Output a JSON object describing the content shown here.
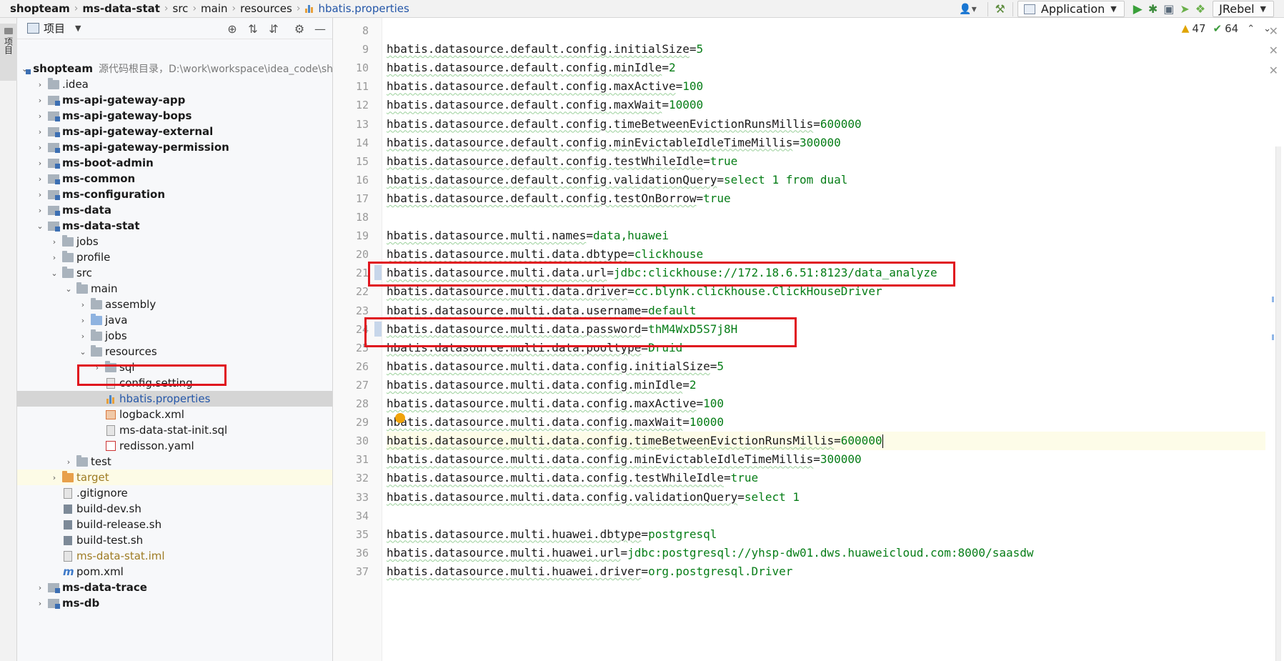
{
  "breadcrumbs": [
    "shopteam",
    "ms-data-stat",
    "src",
    "main",
    "resources",
    "hbatis.properties"
  ],
  "toolbar": {
    "run_config": "Application",
    "jrebel": "JRebel"
  },
  "toolstrip": {
    "project_tab": "项目"
  },
  "project_panel": {
    "title": "项目",
    "root": {
      "name": "shopteam",
      "hint": "源代码根目录，D:\\work\\workspace\\idea_code\\shopt"
    },
    "items": [
      ".idea",
      "ms-api-gateway-app",
      "ms-api-gateway-bops",
      "ms-api-gateway-external",
      "ms-api-gateway-permission",
      "ms-boot-admin",
      "ms-common",
      "ms-configuration",
      "ms-data",
      "ms-data-stat",
      "jobs",
      "profile",
      "src",
      "main",
      "assembly",
      "java",
      "jobs",
      "resources",
      "sql",
      "config.setting",
      "hbatis.properties",
      "logback.xml",
      "ms-data-stat-init.sql",
      "redisson.yaml",
      "test",
      "target",
      ".gitignore",
      "build-dev.sh",
      "build-release.sh",
      "build-test.sh",
      "ms-data-stat.iml",
      "pom.xml",
      "ms-data-trace",
      "ms-db"
    ]
  },
  "editor": {
    "warnings": "47",
    "weak_warnings": "64",
    "lines": [
      {
        "n": "8",
        "k": "",
        "v": ""
      },
      {
        "n": "9",
        "k": "hbatis.datasource.default.config.initialSize",
        "v": "5"
      },
      {
        "n": "10",
        "k": "hbatis.datasource.default.config.minIdle",
        "v": "2"
      },
      {
        "n": "11",
        "k": "hbatis.datasource.default.config.maxActive",
        "v": "100"
      },
      {
        "n": "12",
        "k": "hbatis.datasource.default.config.maxWait",
        "v": "10000"
      },
      {
        "n": "13",
        "k": "hbatis.datasource.default.config.timeBetweenEvictionRunsMillis",
        "v": "600000"
      },
      {
        "n": "14",
        "k": "hbatis.datasource.default.config.minEvictableIdleTimeMillis",
        "v": "300000"
      },
      {
        "n": "15",
        "k": "hbatis.datasource.default.config.testWhileIdle",
        "v": "true"
      },
      {
        "n": "16",
        "k": "hbatis.datasource.default.config.validationQuery",
        "v": "select 1 from dual"
      },
      {
        "n": "17",
        "k": "hbatis.datasource.default.config.testOnBorrow",
        "v": "true"
      },
      {
        "n": "18",
        "k": "",
        "v": ""
      },
      {
        "n": "19",
        "k": "hbatis.datasource.multi.names",
        "v": "data,huawei"
      },
      {
        "n": "20",
        "k": "hbatis.datasource.multi.data.dbtype",
        "v": "clickhouse"
      },
      {
        "n": "21",
        "k": "hbatis.datasource.multi.data.url",
        "v": "jdbc:clickhouse://172.18.6.51:8123/data_analyze"
      },
      {
        "n": "22",
        "k": "hbatis.datasource.multi.data.driver",
        "v": "cc.blynk.clickhouse.ClickHouseDriver"
      },
      {
        "n": "23",
        "k": "hbatis.datasource.multi.data.username",
        "v": "default"
      },
      {
        "n": "24",
        "k": "hbatis.datasource.multi.data.password",
        "v": "thM4WxD5S7j8H"
      },
      {
        "n": "25",
        "k": "hbatis.datasource.multi.data.pooltype",
        "v": "Druid"
      },
      {
        "n": "26",
        "k": "hbatis.datasource.multi.data.config.initialSize",
        "v": "5"
      },
      {
        "n": "27",
        "k": "hbatis.datasource.multi.data.config.minIdle",
        "v": "2"
      },
      {
        "n": "28",
        "k": "hbatis.datasource.multi.data.config.maxActive",
        "v": "100"
      },
      {
        "n": "29",
        "k": "hbatis.datasource.multi.data.config.maxWait",
        "v": "10000"
      },
      {
        "n": "30",
        "k": "hbatis.datasource.multi.data.config.timeBetweenEvictionRunsMillis",
        "v": "600000"
      },
      {
        "n": "31",
        "k": "hbatis.datasource.multi.data.config.minEvictableIdleTimeMillis",
        "v": "300000"
      },
      {
        "n": "32",
        "k": "hbatis.datasource.multi.data.config.testWhileIdle",
        "v": "true"
      },
      {
        "n": "33",
        "k": "hbatis.datasource.multi.data.config.validationQuery",
        "v": "select 1"
      },
      {
        "n": "34",
        "k": "",
        "v": ""
      },
      {
        "n": "35",
        "k": "hbatis.datasource.multi.huawei.dbtype",
        "v": "postgresql"
      },
      {
        "n": "36",
        "k": "hbatis.datasource.multi.huawei.url",
        "v": "jdbc:postgresql://yhsp-dw01.dws.huaweicloud.com:8000/saasdw"
      },
      {
        "n": "37",
        "k": "hbatis.datasource.multi.huawei.driver",
        "v": "org.postgresql.Driver"
      }
    ]
  },
  "colors": {
    "value_green": "#067d17",
    "highlight_red": "#e0141e",
    "selection_grey": "#d5d5d5"
  }
}
